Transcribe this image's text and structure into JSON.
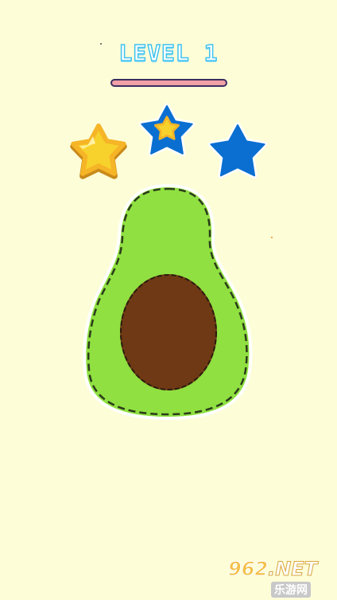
{
  "level": {
    "title": "LEVEL 1",
    "progress": 0,
    "track_color": "#f0a0a6",
    "border_color": "#3a2f60"
  },
  "stars": {
    "total": 3,
    "earned": 1,
    "earned_color": "#f8d22c",
    "empty_color": "#0a6fd1",
    "items": [
      {
        "state": "earned",
        "icon": "gold-star-icon"
      },
      {
        "state": "empty",
        "icon": "blue-star-icon",
        "badge": "small-gold-star-icon"
      },
      {
        "state": "empty",
        "icon": "blue-star-icon"
      }
    ]
  },
  "puzzle": {
    "shape": "avocado",
    "skin_color": "#8fe040",
    "pit_color": "#6e3914",
    "cut_line": "dashed"
  },
  "watermark": {
    "main_prefix": "9",
    "main_num": "62",
    "main_suffix": ".NET",
    "sub": "乐游网"
  },
  "colors": {
    "background": "#fdfdd8",
    "title_stroke": "#3fc3ee"
  }
}
